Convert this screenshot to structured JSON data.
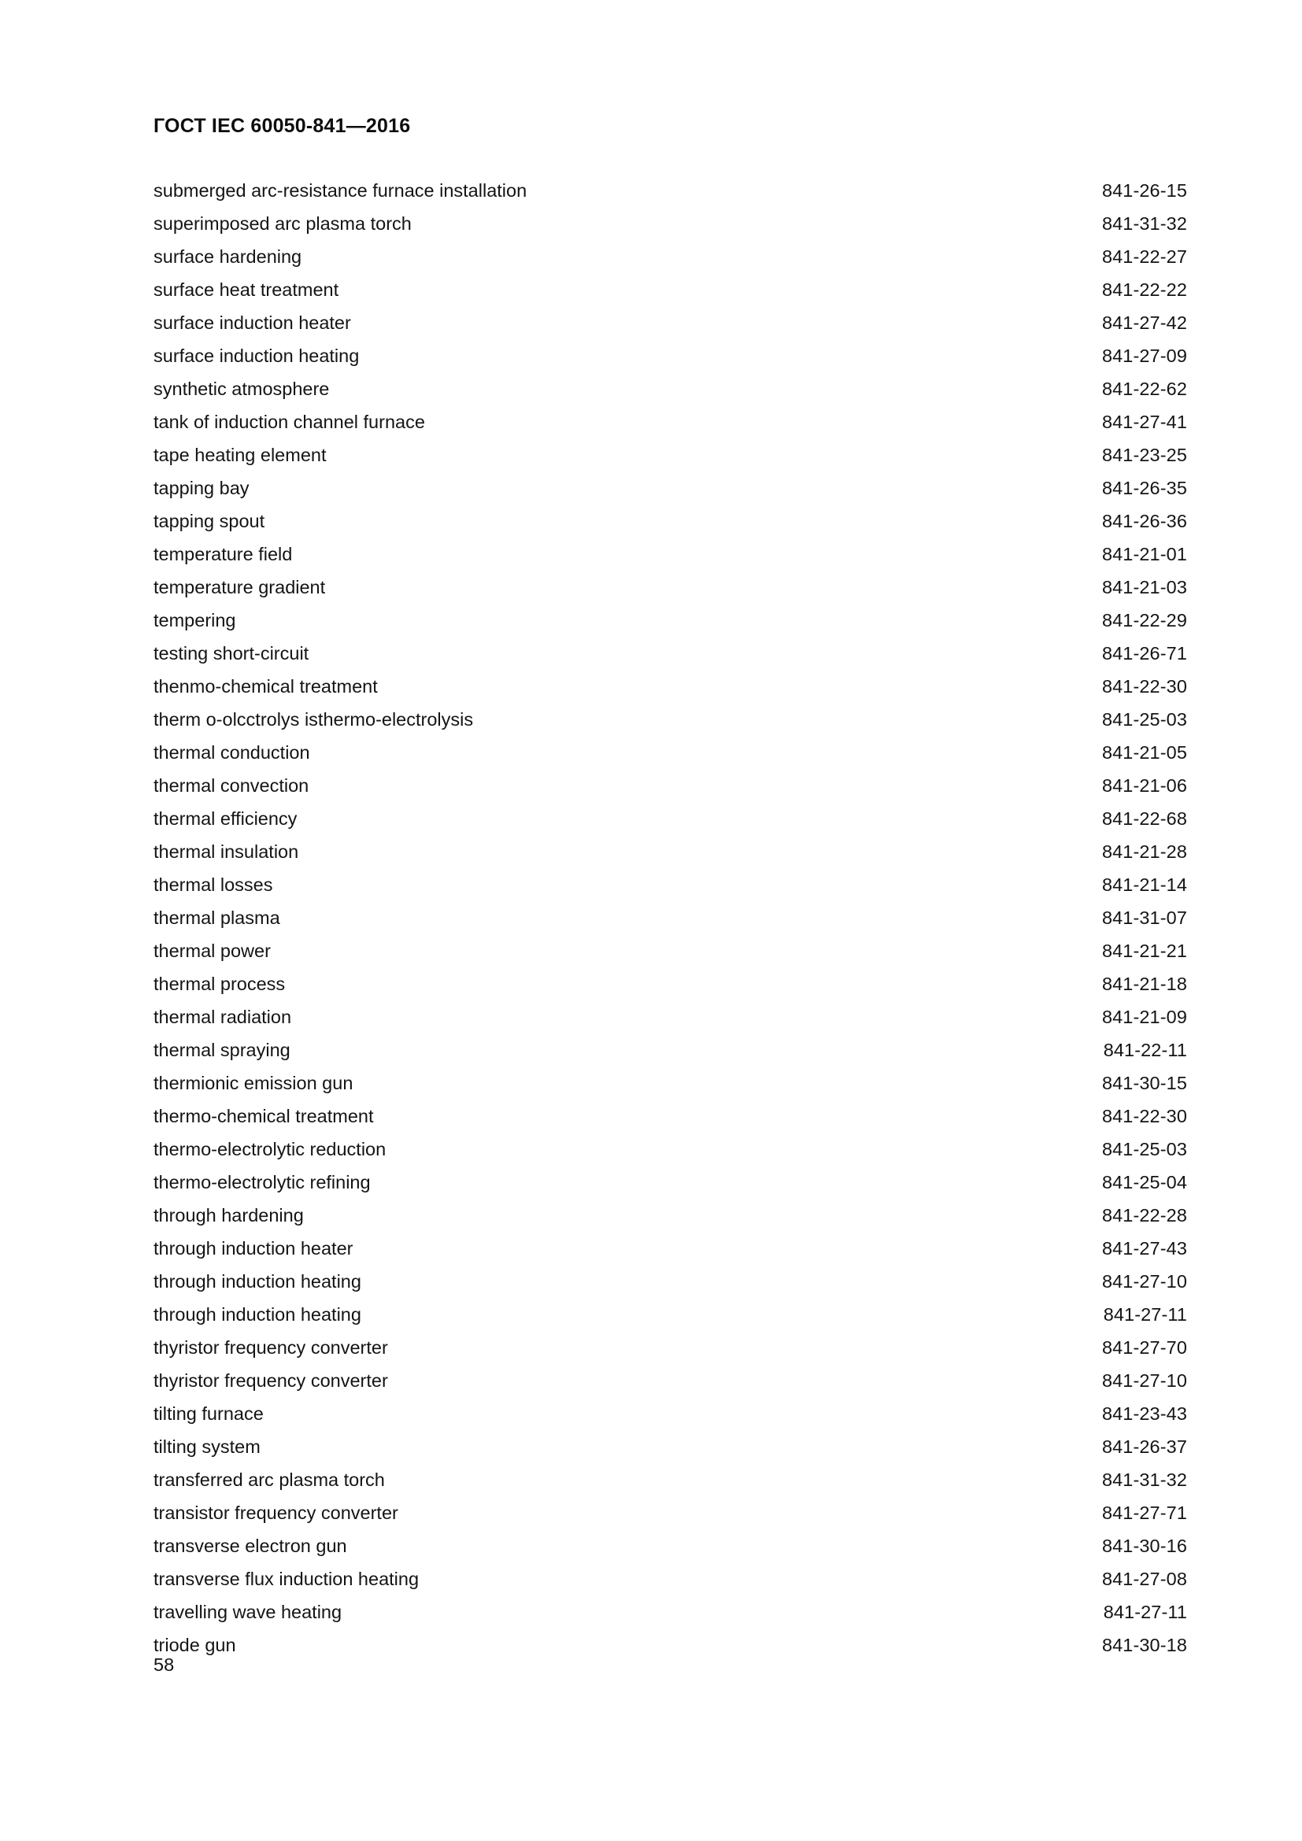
{
  "document": {
    "header_title": "ГОСТ IEC 60050-841—2016",
    "page_number": "58"
  },
  "index": {
    "entries": [
      {
        "term": "submerged arc-resistance furnace installation",
        "code": "841-26-15"
      },
      {
        "term": "superimposed arc plasma torch",
        "code": "841-31-32"
      },
      {
        "term": "surface hardening",
        "code": "841-22-27"
      },
      {
        "term": "surface heat treatment",
        "code": "841-22-22"
      },
      {
        "term": "surface induction heater",
        "code": "841-27-42"
      },
      {
        "term": "surface induction heating",
        "code": "841-27-09"
      },
      {
        "term": "synthetic atmosphere",
        "code": "841-22-62"
      },
      {
        "term": "tank of induction channel furnace",
        "code": "841-27-41"
      },
      {
        "term": "tape heating element",
        "code": "841-23-25"
      },
      {
        "term": "tapping bay",
        "code": "841-26-35"
      },
      {
        "term": "tapping spout",
        "code": "841-26-36"
      },
      {
        "term": "temperature field",
        "code": "841-21-01"
      },
      {
        "term": "temperature gradient",
        "code": "841-21-03"
      },
      {
        "term": "tempering",
        "code": "841-22-29"
      },
      {
        "term": "testing short-circuit",
        "code": "841-26-71"
      },
      {
        "term": "thenmo-chemical treatment",
        "code": "841-22-30"
      },
      {
        "term": "therm o-olcctrolys isthermo-electrolysis",
        "code": "841-25-03"
      },
      {
        "term": "thermal conduction",
        "code": "841-21-05"
      },
      {
        "term": "thermal convection",
        "code": "841-21-06"
      },
      {
        "term": "thermal efficiency",
        "code": "841-22-68"
      },
      {
        "term": "thermal insulation",
        "code": "841-21-28"
      },
      {
        "term": "thermal losses",
        "code": "841-21-14"
      },
      {
        "term": "thermal plasma",
        "code": "841-31-07"
      },
      {
        "term": "thermal power",
        "code": "841-21-21"
      },
      {
        "term": "thermal process",
        "code": "841-21-18"
      },
      {
        "term": "thermal radiation",
        "code": "841-21-09"
      },
      {
        "term": "thermal spraying",
        "code": "841-22-11"
      },
      {
        "term": "thermionic emission gun",
        "code": "841-30-15"
      },
      {
        "term": "thermo-chemical treatment",
        "code": "841-22-30"
      },
      {
        "term": "thermo-electrolytic reduction",
        "code": "841-25-03"
      },
      {
        "term": "thermo-electrolytic refining",
        "code": "841-25-04"
      },
      {
        "term": "through hardening",
        "code": "841-22-28"
      },
      {
        "term": "through induction heater",
        "code": "841-27-43"
      },
      {
        "term": "through induction heating",
        "code": "841-27-10"
      },
      {
        "term": "through induction heating",
        "code": "841-27-11"
      },
      {
        "term": "thyristor frequency converter",
        "code": "841-27-70"
      },
      {
        "term": "thyristor frequency converter",
        "code": "841-27-10"
      },
      {
        "term": "tilting furnace",
        "code": "841-23-43"
      },
      {
        "term": "tilting system",
        "code": "841-26-37"
      },
      {
        "term": "transferred arc plasma torch",
        "code": "841-31-32"
      },
      {
        "term": "transistor frequency converter",
        "code": "841-27-71"
      },
      {
        "term": "transverse electron gun",
        "code": "841-30-16"
      },
      {
        "term": "transverse flux induction heating",
        "code": "841-27-08"
      },
      {
        "term": "travelling wave heating",
        "code": "841-27-11"
      },
      {
        "term": "triode gun",
        "code": "841-30-18"
      }
    ]
  }
}
